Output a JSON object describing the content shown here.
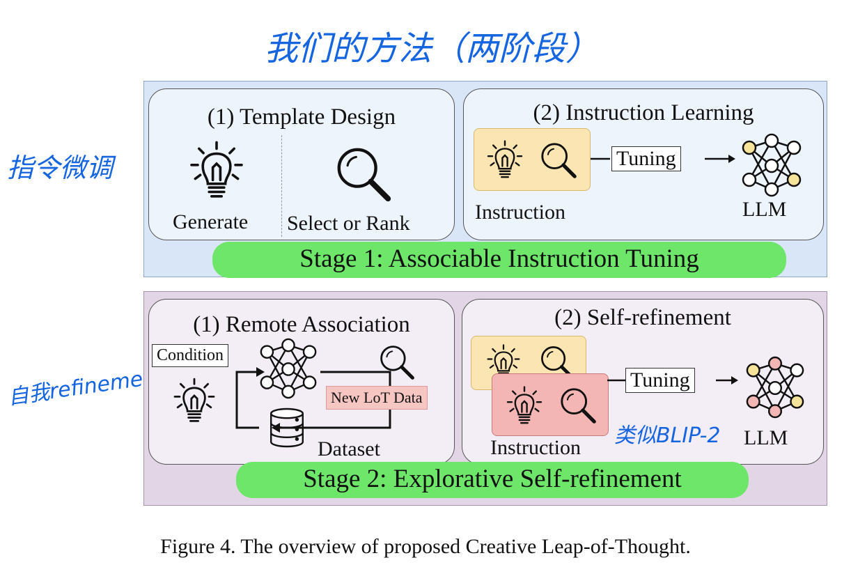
{
  "annotations": {
    "title": "我们的方法（两阶段）",
    "left_stage1": "指令微调",
    "left_stage2": "自我refinement",
    "note_stage2": "类似BLIP-2"
  },
  "stage1": {
    "banner": "Stage 1: Associable Instruction Tuning",
    "panel_template": {
      "title": "(1) Template Design",
      "generate": "Generate",
      "select_rank": "Select or Rank"
    },
    "panel_instruction": {
      "title": "(2) Instruction Learning",
      "instruction": "Instruction",
      "tuning": "Tuning",
      "llm": "LLM"
    }
  },
  "stage2": {
    "banner": "Stage 2: Explorative Self-refinement",
    "panel_remote": {
      "title": "(1) Remote Association",
      "condition": "Condition",
      "new_data": "New LoT Data",
      "dataset": "Dataset"
    },
    "panel_refine": {
      "title": "(2) Self-refinement",
      "instruction": "Instruction",
      "tuning": "Tuning",
      "llm": "LLM"
    }
  },
  "caption": "Figure 4. The overview of proposed Creative Leap-of-Thought.",
  "colors": {
    "stage1_bg": "#d9e6f7",
    "stage2_bg": "#e2d6e6",
    "banner_green": "#6de66a",
    "instruction_yellow": "#fbe6b3",
    "instruction_red": "#f4b6b4",
    "annotation_blue": "#1565e0"
  }
}
